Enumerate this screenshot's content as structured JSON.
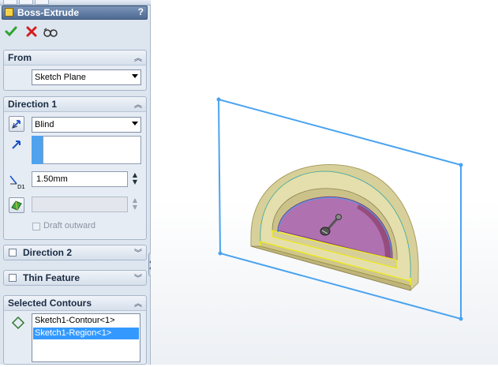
{
  "property_manager": {
    "title": "Boss-Extrude",
    "help_label": "?",
    "actions": {
      "ok_icon": "green-check-icon",
      "cancel_icon": "red-x-icon",
      "preview_icon": "detailed-preview-icon"
    },
    "from": {
      "header": "From",
      "start_condition": "Sketch Plane"
    },
    "direction1": {
      "header": "Direction 1",
      "end_condition": "Blind",
      "direction_value": "",
      "depth": "1.50mm",
      "draft_value": "",
      "draft_outward_label": "Draft outward",
      "draft_outward_checked": false
    },
    "direction2": {
      "header": "Direction 2",
      "checked": false
    },
    "thin_feature": {
      "header": "Thin Feature",
      "checked": false
    },
    "selected_contours": {
      "header": "Selected Contours",
      "items": [
        "Sketch1-Contour<1>",
        "Sketch1-Region<1>"
      ],
      "selected_index": 1
    }
  },
  "colors": {
    "plane_outline": "#4aa3f0",
    "part_face": "#e3dca6",
    "region_fill": "#b070b0",
    "selection_edge": "#f3f000",
    "title_bar": "#5a759c"
  }
}
